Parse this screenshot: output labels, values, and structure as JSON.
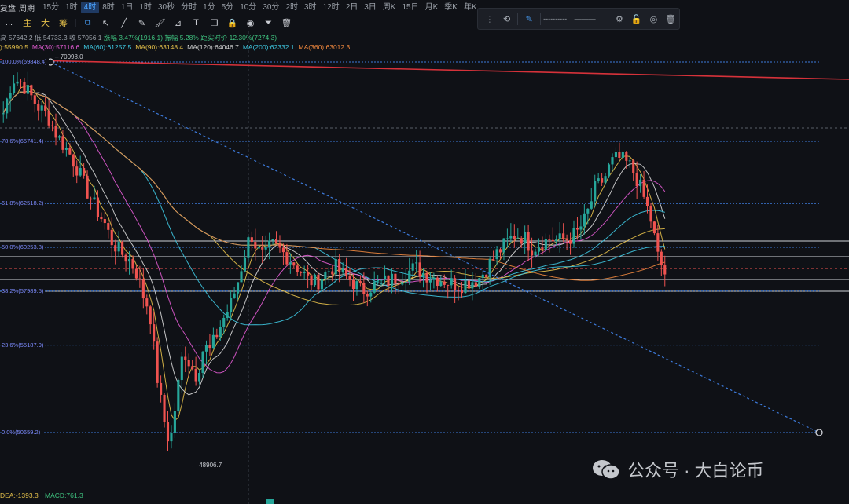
{
  "periodbar": {
    "lead": "复盘",
    "period": "周期",
    "items": [
      "15分",
      "1时",
      "4时",
      "8时",
      "1日",
      "1时",
      "30秒",
      "分时",
      "1分",
      "5分",
      "10分",
      "30分",
      "2时",
      "3时",
      "12时",
      "2日",
      "3日",
      "周K",
      "15日",
      "月K",
      "季K",
      "年K"
    ],
    "active_index": 2
  },
  "toolbar2": {
    "more": "...",
    "main": "主",
    "big": "大",
    "chip": "筹"
  },
  "drawbar": {
    "line_style": "----------",
    "line_width": "———"
  },
  "info": {
    "high": "高 57642.2",
    "low": "低 54733.3",
    "close": "收 57056.1",
    "change": "涨幅 3.47%(1916.1)",
    "amplitude": "振幅 5.28%",
    "distance": "距实时价 12.30%(7274.3)"
  },
  "ma_row": [
    {
      "text": "):55990.5",
      "color": "#e5c04a"
    },
    {
      "text": "MA(30):57116.6",
      "color": "#e05ad0"
    },
    {
      "text": "MA(60):61257.5",
      "color": "#3ec7e0"
    },
    {
      "text": "MA(90):63148.4",
      "color": "#e5c04a"
    },
    {
      "text": "MA(120):64046.7",
      "color": "#d6d6d6"
    },
    {
      "text": "MA(200):62332.1",
      "color": "#3ec7e0"
    },
    {
      "text": "MA(360):63012.3",
      "color": "#f0883e"
    }
  ],
  "fib_levels": [
    {
      "label": "100.0%(69848.4)",
      "value": 69848.4
    },
    {
      "label": "78.6%(65741.4)",
      "value": 65741.4
    },
    {
      "label": "61.8%(62518.2)",
      "value": 62518.2
    },
    {
      "label": "50.0%(60253.8)",
      "value": 60253.8
    },
    {
      "label": "38.2%(57989.5)",
      "value": 57989.5
    },
    {
      "label": "23.6%(55187.9)",
      "value": 55187.9
    },
    {
      "label": "0.0%(50659.2)",
      "value": 50659.2
    }
  ],
  "annotations": {
    "high_label": "70098.0",
    "low_label": "48906.7"
  },
  "macd_row": {
    "dea": "DEA:-1393.3",
    "macd": "MACD:761.3"
  },
  "watermark": {
    "text": "公众号 · 大白论币"
  },
  "colors": {
    "up": "#26a69a",
    "down": "#ef5350",
    "fib": "#3d7bdc",
    "trend_red": "#d6323a"
  }
}
